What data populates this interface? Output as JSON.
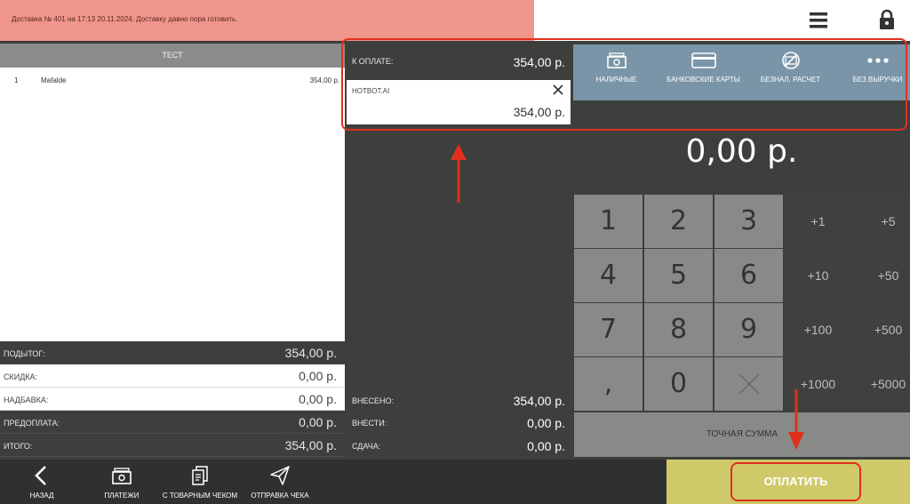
{
  "notice": "Доставка № 401 на 17:13 20.11.2024. Доставку давно пора готовить.",
  "order": {
    "title": "ТЕСТ",
    "items": [
      {
        "num": "1",
        "name": "Mafalde",
        "price": "354,00 р."
      }
    ]
  },
  "totals": [
    {
      "label": "ПОДЫТОГ:",
      "value": "354,00 р.",
      "style": "dark"
    },
    {
      "label": "СКИДКА:",
      "value": "0,00 р.",
      "style": "white"
    },
    {
      "label": "НАДБАВКА:",
      "value": "0,00 р.",
      "style": "white"
    },
    {
      "label": "ПРЕДОПЛАТА:",
      "value": "0,00 р.",
      "style": "dark"
    },
    {
      "label": "ИТОГО:",
      "value": "354,00 р.",
      "style": "dark"
    }
  ],
  "payment": {
    "to_pay_label": "К ОПЛАТЕ:",
    "to_pay_value": "354,00 р.",
    "method_name": "HOTBOT.AI",
    "method_amount": "354,00 р.",
    "deposited_label": "ВНЕСЕНО:",
    "deposited_value": "354,00 р.",
    "to_deposit_label": "ВНЕСТИ:",
    "to_deposit_value": "0,00 р.",
    "change_label": "СДАЧА:",
    "change_value": "0,00 р."
  },
  "methods": [
    {
      "label": "НАЛИЧНЫЕ",
      "icon": "cash-icon"
    },
    {
      "label": "БАНКОВСКИЕ КАРТЫ",
      "icon": "bank-card-icon"
    },
    {
      "label": "БЕЗНАЛ. РАСЧЕТ",
      "icon": "no-cash-icon"
    },
    {
      "label": "БЕЗ ВЫРУЧКИ",
      "icon": "more-icon"
    }
  ],
  "display_amount": "0,00 р.",
  "keypad": {
    "digits": [
      "1",
      "2",
      "3",
      "4",
      "5",
      "6",
      "7",
      "8",
      "9",
      ",",
      "0"
    ],
    "quick": [
      "+1",
      "+5",
      "+10",
      "+50",
      "+100",
      "+500",
      "+1000",
      "+5000"
    ],
    "exact_label": "ТОЧНАЯ СУММА"
  },
  "bottom": {
    "back": "НАЗАД",
    "payments": "ПЛАТЕЖИ",
    "with_receipt": "С ТОВАРНЫМ ЧЕКОМ",
    "send_receipt": "ОТПРАВКА ЧЕКА",
    "pay": "ОПЛАТИТЬ"
  },
  "colors": {
    "accent": "#cfc96a",
    "notice": "#f0958a",
    "methods_bg": "#7a95a8",
    "annotation": "#e0301c"
  }
}
